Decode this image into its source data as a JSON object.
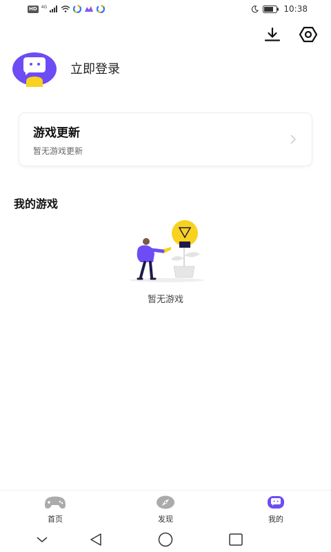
{
  "status_bar": {
    "hd_badge": "HD",
    "network": "4G",
    "time": "10:38"
  },
  "top_actions": {
    "download_icon": "download-icon",
    "settings_icon": "settings-icon"
  },
  "login": {
    "label": "立即登录"
  },
  "updates_card": {
    "title": "游戏更新",
    "subtitle": "暂无游戏更新"
  },
  "my_games": {
    "title": "我的游戏",
    "empty_text": "暂无游戏"
  },
  "bottom_nav": {
    "items": [
      {
        "label": "首页",
        "icon": "gamepad-icon"
      },
      {
        "label": "发现",
        "icon": "compass-icon"
      },
      {
        "label": "我的",
        "icon": "mascot-icon",
        "active": true
      }
    ]
  },
  "colors": {
    "brand": "#6d4cf5",
    "accent_yellow": "#f8d21f"
  }
}
